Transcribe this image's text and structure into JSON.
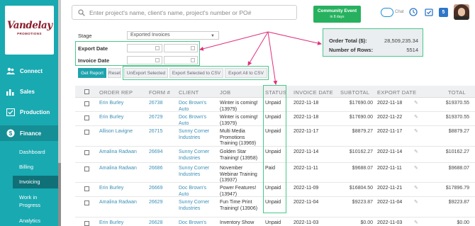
{
  "brand": {
    "logo_text": "Vandelay",
    "logo_sub": "PROMOTIONS"
  },
  "sidebar": {
    "main": [
      {
        "label": "Connect",
        "icon": "people-icon"
      },
      {
        "label": "Sales",
        "icon": "bar-chart-icon"
      },
      {
        "label": "Production",
        "icon": "production-icon"
      },
      {
        "label": "Finance",
        "icon": "dollar-icon"
      }
    ],
    "sub": [
      "Dashboard",
      "Billing",
      "Invoicing",
      "Work in Progress",
      "Analytics"
    ]
  },
  "search": {
    "placeholder": "Enter project's name, client's name, project's number or PO#"
  },
  "community": {
    "title": "Community Event",
    "subtitle": "in 8 days"
  },
  "chat": {
    "label": "Chat"
  },
  "badge_count": "5",
  "filters": {
    "stage_label": "Stage",
    "stage_value": "Exported Invoices",
    "export_date_label": "Export Date",
    "invoice_date_label": "Invoice Date"
  },
  "buttons": {
    "get_report": "Get Report",
    "reset": "Reset",
    "unexport": "UnExport Selected",
    "export_selected": "Export Selected to CSV",
    "export_all": "Export All to CSV"
  },
  "summary": {
    "order_total_label": "Order Total ($):",
    "order_total_value": "28,509,235.34",
    "rows_label": "Number of Rows:",
    "rows_value": "5514"
  },
  "table": {
    "headers": [
      "ORDER REP",
      "FORM #",
      "CLIENT",
      "JOB",
      "STATUS",
      "INVOICE DATE",
      "SUBTOTAL",
      "EXPORT DATE",
      "TOTAL"
    ],
    "rows": [
      {
        "rep": "Erin Burley",
        "form": "26738",
        "client": "Doc Brown's Auto",
        "job": "Winter is coming! (13979)",
        "status": "Unpaid",
        "invoice_date": "2022-11-18",
        "subtotal": "$17690.00",
        "export_date": "2022-11-18",
        "total": "$19370.55"
      },
      {
        "rep": "Erin Burley",
        "form": "26729",
        "client": "Doc Brown's Auto",
        "job": "Winter is coming! (13979)",
        "status": "Unpaid",
        "invoice_date": "2022-11-18",
        "subtotal": "$17690.00",
        "export_date": "2022-11-22",
        "total": "$19370.55"
      },
      {
        "rep": "Allison Lavigne",
        "form": "26715",
        "client": "Sunny Corner Industries",
        "job": "Multi Media Promotions Training (13969)",
        "status": "Unpaid",
        "invoice_date": "2022-11-17",
        "subtotal": "$8879.27",
        "export_date": "2022-11-17",
        "total": "$8879.27"
      },
      {
        "rep": "Amalina Radwan",
        "form": "26694",
        "client": "Sunny Corner Industries",
        "job": "Golden Star Training! (13958)",
        "status": "Unpaid",
        "invoice_date": "2022-11-14",
        "subtotal": "$10162.27",
        "export_date": "2022-11-14",
        "total": "$10162.27"
      },
      {
        "rep": "Amalina Radwan",
        "form": "26686",
        "client": "Sunny Corner Industries",
        "job": "November Webinar Training (13937)",
        "status": "Paid",
        "invoice_date": "2022-11-11",
        "subtotal": "$9688.07",
        "export_date": "2022-11-11",
        "total": "$9688.07"
      },
      {
        "rep": "Erin Burley",
        "form": "26669",
        "client": "Doc Brown's Auto",
        "job": "Power Features! (13947)",
        "status": "Unpaid",
        "invoice_date": "2022-11-09",
        "subtotal": "$16804.50",
        "export_date": "2022-11-21",
        "total": "$17896.79"
      },
      {
        "rep": "Amalina Radwan",
        "form": "26629",
        "client": "Sunny Corner Industries",
        "job": "Fun Time Print Training! (13906)",
        "status": "Unpaid",
        "invoice_date": "2022-11-04",
        "subtotal": "$9223.87",
        "export_date": "2022-11-04",
        "total": "$9223.87"
      },
      {
        "rep": "Erin Burley",
        "form": "26628",
        "client": "Doc Brown's Auto",
        "job": "Inventory Show",
        "status": "Unpaid",
        "invoice_date": "2022-11-03",
        "subtotal": "$0.00",
        "export_date": "2022-11-03",
        "total": "$0.00"
      }
    ]
  },
  "colors": {
    "sidebar": "#19a9b1",
    "highlight": "#49c889",
    "arrow": "#e0307e",
    "link": "#3a8fb5"
  }
}
